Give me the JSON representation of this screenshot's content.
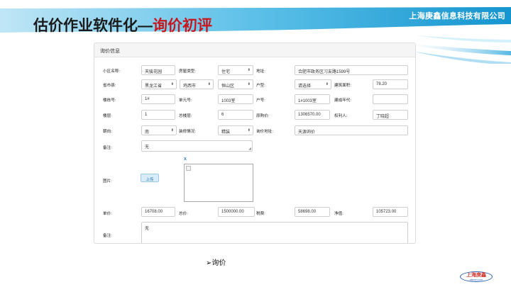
{
  "slide": {
    "company": "上海庚鑫信息科技有限公司",
    "title_prefix": "估价作业软件化—",
    "title_highlight": "询价初评",
    "caption": "➢询价",
    "logo_main": "上海庚鑫",
    "logo_sub": "dlwxsn.com"
  },
  "panel": {
    "title": "询价信息"
  },
  "form": {
    "community_label": "小区名称:",
    "community_value": "天骏花园",
    "house_type_label": "房屋类型:",
    "house_type_value": "住宅",
    "address_label": "地址:",
    "address_value": "合肥市政务区习友路1599号",
    "province_label": "省市县:",
    "province_value": "黑龙江省",
    "city_value": "鸡西市",
    "county_value": "恒山区",
    "layout_label": "户型:",
    "layout_value": "请选择",
    "area_label": "建筑面积:",
    "area_value": "78.20",
    "building_label": "楼栋号:",
    "building_value": "1#",
    "unit_label": "单元号:",
    "unit_value": "1003室",
    "room_label": "户号:",
    "room_value": "1#1003室",
    "year_label": "建成年代:",
    "year_value": "",
    "floor_label": "楼层:",
    "floor_value": "1",
    "total_floor_label": "总楼层:",
    "total_floor_value": "6",
    "orig_price_label": "原购价:",
    "orig_price_value": "1306570.00",
    "owner_label": "权利人:",
    "owner_value": "丁晓超",
    "orientation_label": "朝向:",
    "orientation_value": "南",
    "decoration_label": "装修情况:",
    "decoration_value": "精装",
    "inquiry_addr_label": "询价地址:",
    "inquiry_addr_value": "天源询价",
    "remark_label": "备注:",
    "remark_value": "无",
    "image_label": "图片:",
    "upload_label": "上传",
    "image_close": "x",
    "unit_price_label": "单价:",
    "unit_price_value": "16708.00",
    "total_price_label": "总价:",
    "total_price_value": "1500000.00",
    "tax_label": "税费:",
    "tax_value": "58698.00",
    "net_label": "净值:",
    "net_value": "105723.00",
    "remark2_label": "备注:",
    "remark2_value": "无"
  },
  "colors": {
    "header_blue": "#1fa3d8",
    "title_red": "#c8161d",
    "button_blue": "#d8ebf8"
  }
}
